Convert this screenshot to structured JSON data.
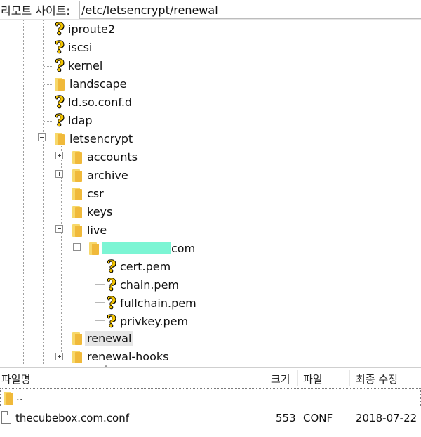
{
  "address_bar": {
    "label": "리모트 사이트:",
    "path": "/etc/letsencrypt/renewal"
  },
  "tree": {
    "iproute2": "iproute2",
    "iscsi": "iscsi",
    "kernel": "kernel",
    "landscape": "landscape",
    "ld_so_conf_d": "ld.so.conf.d",
    "ldap": "ldap",
    "letsencrypt": "letsencrypt",
    "accounts": "accounts",
    "archive": "archive",
    "csr": "csr",
    "keys": "keys",
    "live": "live",
    "domain_suffix": "com",
    "cert_pem": "cert.pem",
    "chain_pem": "chain.pem",
    "fullchain_pem": "fullchain.pem",
    "privkey_pem": "privkey.pem",
    "renewal": "renewal",
    "renewal_hooks": "renewal-hooks"
  },
  "file_list": {
    "columns": {
      "name": "파일명",
      "size": "크기",
      "type": "파일",
      "modified": "최종 수정"
    },
    "parent_dir_label": "..",
    "rows": [
      {
        "name": "thecubebox.com.conf",
        "size": "553",
        "type": "CONF",
        "modified": "2018-07-22"
      }
    ]
  },
  "colors": {
    "folder": "#f0b93a",
    "unknown_icon": "#f4c400",
    "redaction_highlight": "#7cf5d4",
    "selection": "#e6e6e6"
  }
}
